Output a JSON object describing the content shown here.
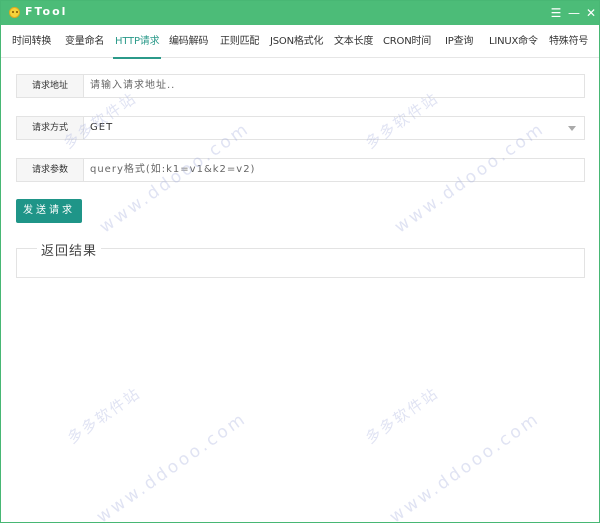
{
  "window": {
    "title": "FTool",
    "logo_icon": "smiley-icon",
    "controls": {
      "menu": "☰",
      "minimize": "—",
      "close": "✕"
    },
    "accent_color": "#4cbc78"
  },
  "tabs": [
    {
      "label": "时间转换"
    },
    {
      "label": "变量命名"
    },
    {
      "label": "HTTP请求"
    },
    {
      "label": "编码解码"
    },
    {
      "label": "正则匹配"
    },
    {
      "label": "JSON格式化"
    },
    {
      "label": "文本长度"
    },
    {
      "label": "CRON时间"
    },
    {
      "label": "IP查询"
    },
    {
      "label": "LINUX命令"
    },
    {
      "label": "特殊符号"
    }
  ],
  "active_tab": "HTTP请求",
  "form": {
    "url": {
      "label": "请求地址",
      "placeholder": "请输入请求地址.."
    },
    "method": {
      "label": "请求方式",
      "value": "GET"
    },
    "params": {
      "label": "请求参数",
      "placeholder": "query格式(如:k1=v1&k2=v2)"
    },
    "send_button": "发送请求"
  },
  "result": {
    "legend": "返回结果"
  },
  "watermark": {
    "cn": "多多软件站",
    "en": "www.ddooo.com"
  },
  "colors": {
    "primary": "#1f9588",
    "active_tab": "#2b9a8a"
  }
}
